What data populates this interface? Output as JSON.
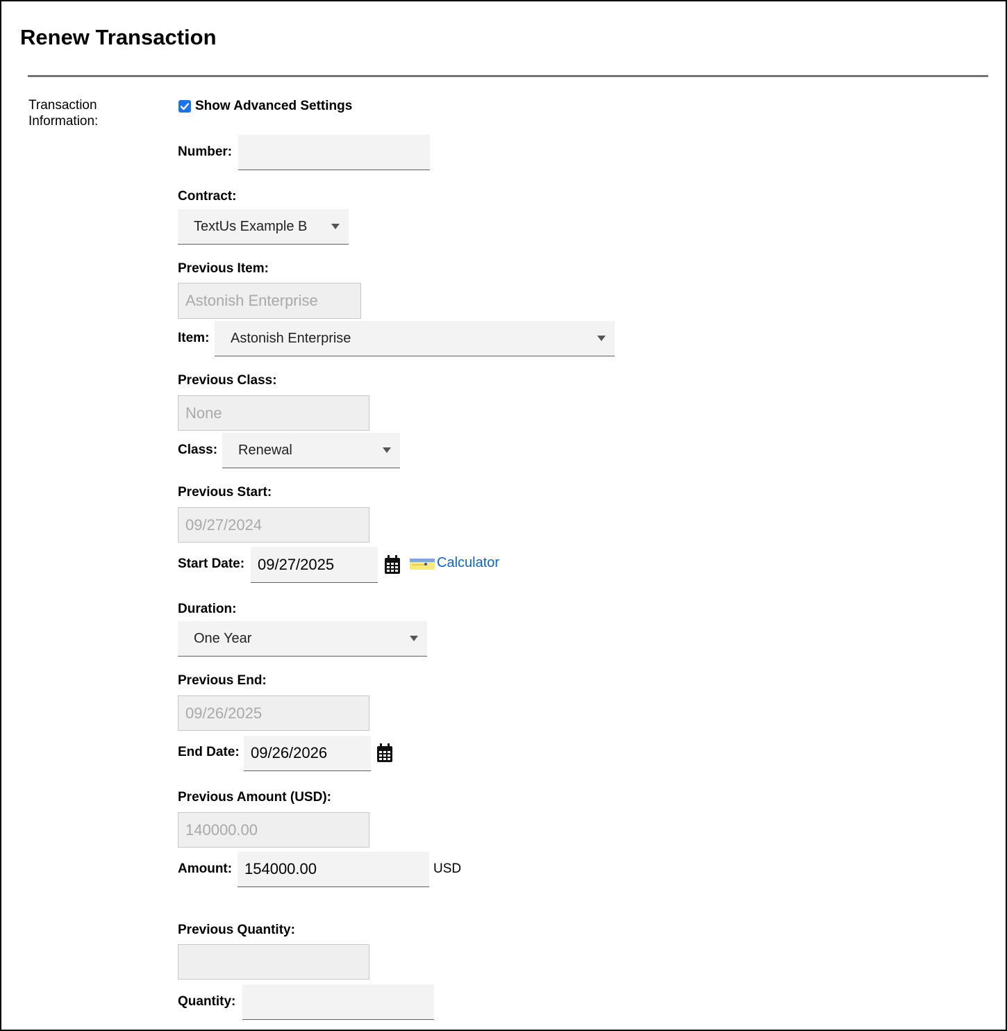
{
  "title": "Renew Transaction",
  "section_label": "Transaction Information:",
  "advanced": {
    "label": "Show Advanced Settings",
    "checked": true
  },
  "fields": {
    "number": {
      "label": "Number:",
      "value": ""
    },
    "contract": {
      "label": "Contract:",
      "value": "TextUs Example B"
    },
    "previous_item": {
      "label": "Previous Item:",
      "value": "Astonish Enterprise"
    },
    "item": {
      "label": "Item:",
      "value": "Astonish Enterprise"
    },
    "previous_class": {
      "label": "Previous Class:",
      "value": "None"
    },
    "class": {
      "label": "Class:",
      "value": "Renewal"
    },
    "previous_start": {
      "label": "Previous Start:",
      "value": "09/27/2024"
    },
    "start_date": {
      "label": "Start Date:",
      "value": "09/27/2025",
      "calculator_label": "Calculator"
    },
    "duration": {
      "label": "Duration:",
      "value": "One Year"
    },
    "previous_end": {
      "label": "Previous End:",
      "value": "09/26/2025"
    },
    "end_date": {
      "label": "End Date:",
      "value": "09/26/2026"
    },
    "previous_amount": {
      "label": "Previous Amount (USD):",
      "value": "140000.00"
    },
    "amount": {
      "label": "Amount:",
      "value": "154000.00",
      "currency": "USD"
    },
    "previous_quantity": {
      "label": "Previous Quantity:",
      "value": ""
    },
    "quantity": {
      "label": "Quantity:",
      "value": ""
    }
  },
  "icons": {
    "calendar": "calendar-icon",
    "calculator": "calculator-icon",
    "dropdown": "chevron-down-icon",
    "checkbox": "checkbox-checked-icon"
  },
  "colors": {
    "accent": "#1a73e8",
    "link": "#0a66c2",
    "divider": "#737373"
  }
}
